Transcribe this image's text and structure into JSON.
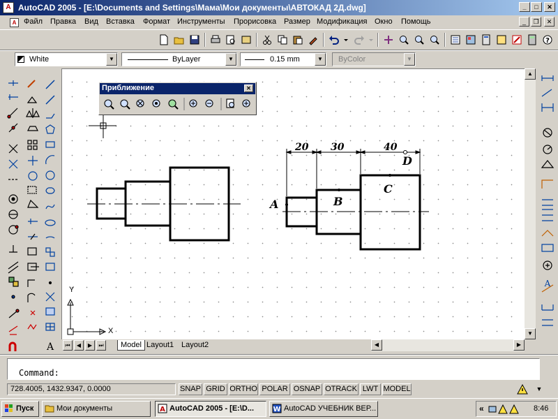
{
  "window": {
    "title": "AutoCAD 2005 - [E:\\Documents and Settings\\Мама\\Мои документы\\АВТОКАД 2Д.dwg]",
    "icon": "autocad-app-icon"
  },
  "menubar": {
    "items": [
      "Файл",
      "Правка",
      "Вид",
      "Вставка",
      "Формат",
      "Инструменты",
      "Прорисовка",
      "Размер",
      "Модификация",
      "Окно",
      "Помощь"
    ]
  },
  "properties": {
    "color": "White",
    "linetype": "ByLayer",
    "lineweight": "0.15 mm",
    "plotstyle": "ByColor"
  },
  "zoom_toolbar": {
    "title": "Приближение",
    "close": "✕"
  },
  "drawing": {
    "dimensions": [
      "20",
      "30",
      "40"
    ],
    "point_labels": [
      "A",
      "B",
      "C",
      "D"
    ],
    "ucs": {
      "x": "X",
      "y": "Y"
    }
  },
  "tabs": [
    "Model",
    "Layout1",
    "Layout2"
  ],
  "command": {
    "prompt": "Command:"
  },
  "status": {
    "coordinates": "728.4005, 1432.9347, 0.0000",
    "toggles": [
      "SNAP",
      "GRID",
      "ORTHO",
      "POLAR",
      "OSNAP",
      "OTRACK",
      "LWT",
      "MODEL"
    ]
  },
  "taskbar": {
    "start": "Пуск",
    "tasks": [
      {
        "label": "Мои документы"
      },
      {
        "label": "AutoCAD 2005 - [E:\\D..."
      },
      {
        "label": "AutoCAD УЧЕБНИК ВЕР..."
      }
    ],
    "tray_chevron": "«",
    "clock": "8:46"
  },
  "colors": {
    "titlebar_start": "#0a246a",
    "titlebar_end": "#a6caf0",
    "workspace": "#ffffff"
  }
}
